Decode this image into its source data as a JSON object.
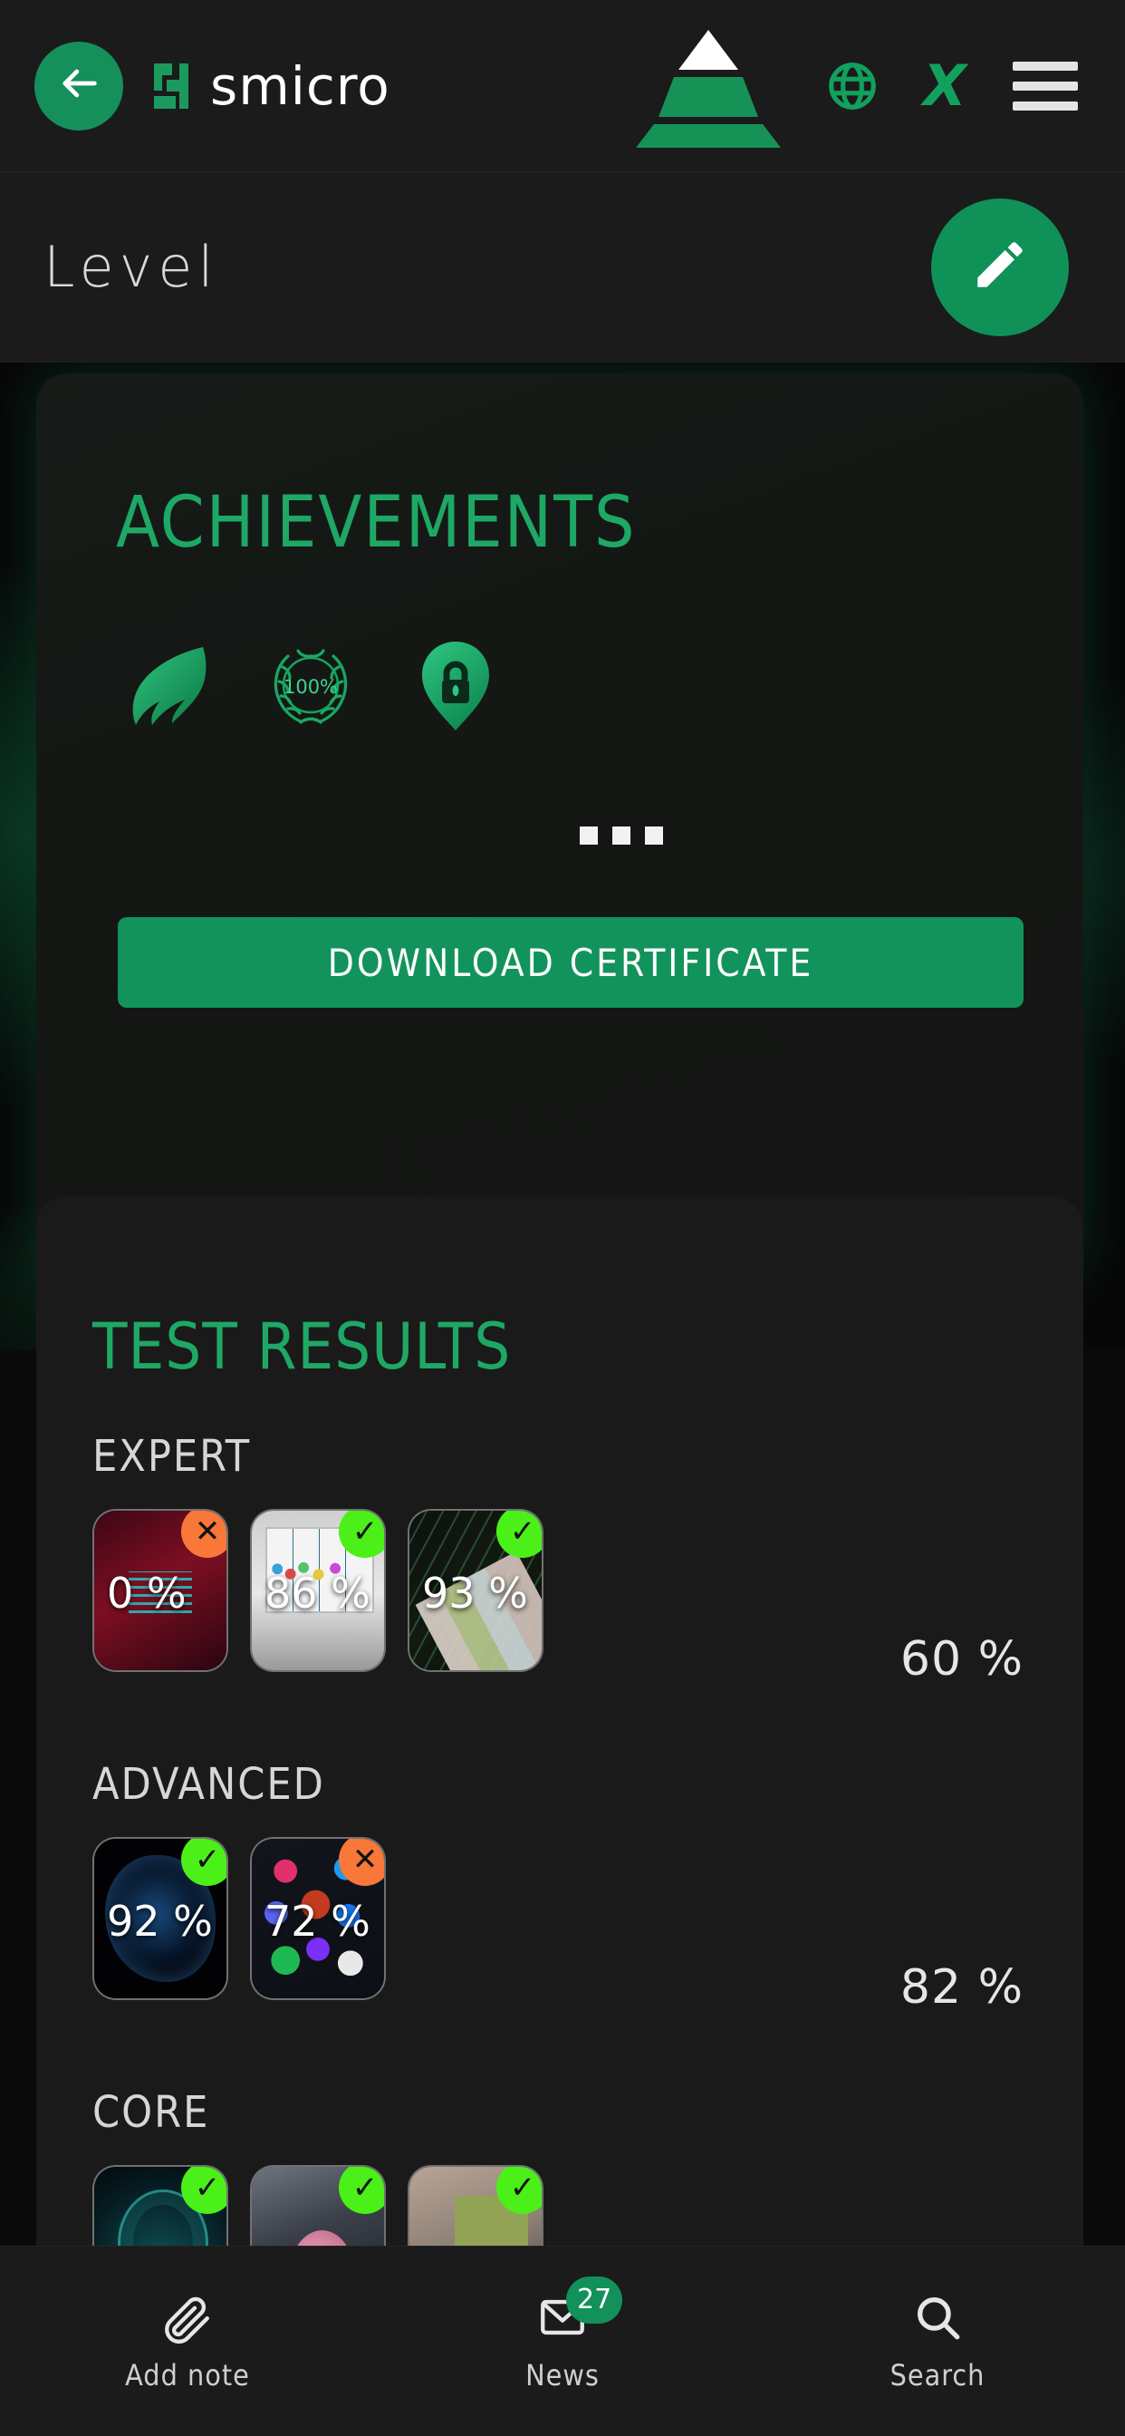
{
  "header": {
    "back_icon": "arrow-left-icon",
    "logo_text": "smicro",
    "logo_mark": "smicro-logo-mark",
    "pyramid_icon": "pyramid-icon",
    "globe_icon": "globe-icon",
    "x_logo": "X",
    "menu_icon": "hamburger-menu-icon"
  },
  "titlebar": {
    "title": "Level",
    "edit_icon": "pencil-edit-icon"
  },
  "achievements": {
    "title": "ACHIEVEMENTS",
    "badges": [
      {
        "name": "wing-badge-icon",
        "label": ""
      },
      {
        "name": "laurel-wreath-badge-icon",
        "label": "100%"
      },
      {
        "name": "shield-lock-badge-icon",
        "label": ""
      }
    ],
    "more_indicator": "three-dots-more",
    "download_label": "DOWNLOAD CERTIFICATE"
  },
  "test_results": {
    "title": "TEST RESULTS",
    "groups": [
      {
        "label": "EXPERT",
        "score": "60 %",
        "items": [
          {
            "pct": "0 %",
            "status": "fail",
            "mark": "✕",
            "art": "art-imagine"
          },
          {
            "pct": "86 %",
            "status": "pass",
            "mark": "✓",
            "art": "art-board"
          },
          {
            "pct": "93 %",
            "status": "pass",
            "mark": "✓",
            "art": "art-mixer"
          }
        ]
      },
      {
        "label": "ADVANCED",
        "score": "82 %",
        "items": [
          {
            "pct": "92 %",
            "status": "pass",
            "mark": "✓",
            "art": "art-brain"
          },
          {
            "pct": "72 %",
            "status": "fail",
            "mark": "✕",
            "art": "art-social"
          }
        ]
      },
      {
        "label": "CORE",
        "score": "",
        "items": [
          {
            "pct": "",
            "status": "pass",
            "mark": "✓",
            "art": "art-radar"
          },
          {
            "pct": "",
            "status": "pass",
            "mark": "✓",
            "art": "art-pink"
          },
          {
            "pct": "",
            "status": "pass",
            "mark": "✓",
            "art": "art-desk"
          }
        ]
      }
    ]
  },
  "bottom_nav": [
    {
      "label": "Add note",
      "icon": "paperclip-icon",
      "badge": ""
    },
    {
      "label": "News",
      "icon": "envelope-icon",
      "badge": "27"
    },
    {
      "label": "Search",
      "icon": "search-icon",
      "badge": ""
    }
  ],
  "colors": {
    "brand_green": "#12915b",
    "accent_green": "#1ea865",
    "pass_green": "#4bf019",
    "fail_orange": "#f97738",
    "background": "#0a0a0a",
    "surface": "#1b1b1b"
  }
}
